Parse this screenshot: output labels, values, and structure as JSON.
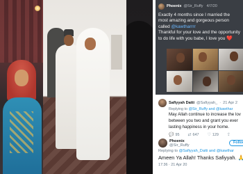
{
  "tweet": {
    "name": "Phoenix",
    "handle": "@Sir_Ruffy",
    "date": "4/7/20",
    "text_part1": "Exactly 4 months since I married the most amazing and gorgeous person called ",
    "mention": "@kawtharrrr",
    "text_part2": "Thankful for your love and the opportunity to do life with you babe, I love you",
    "heart": "❤️"
  },
  "reply1": {
    "name": "Safiyyah Datti",
    "handle": "@Safiyyah_",
    "date": "21 Apr 2",
    "replying_label": "Replying to",
    "replying_handles": "@Sir_Ruffy and @kawthar",
    "body_line1": "May Allah continue to increase the lov",
    "body_line2": "between you two and grant you ever",
    "body_line3": "lasting happiness in your home.",
    "reply_count": "95",
    "retweet_count": "647",
    "like_count": "129"
  },
  "reply2": {
    "name": "Phoenix",
    "handle": "@Sir_Ruffy",
    "follow_label": "Follow",
    "replying_label": "Replying to",
    "replying_handles": "@Safiyyah_Datti and @kawthar",
    "body": "Ameen Ya Allah! Thanks Safiyyah. 🙏",
    "time": "17:36 · 21 Apr 20"
  },
  "icons": {
    "reply": "reply-icon",
    "retweet": "retweet-icon",
    "like": "like-icon",
    "share": "share-icon"
  },
  "colors": {
    "link": "#1b95e0",
    "heart": "#e0245e",
    "card_bg": "#3a3e44"
  }
}
